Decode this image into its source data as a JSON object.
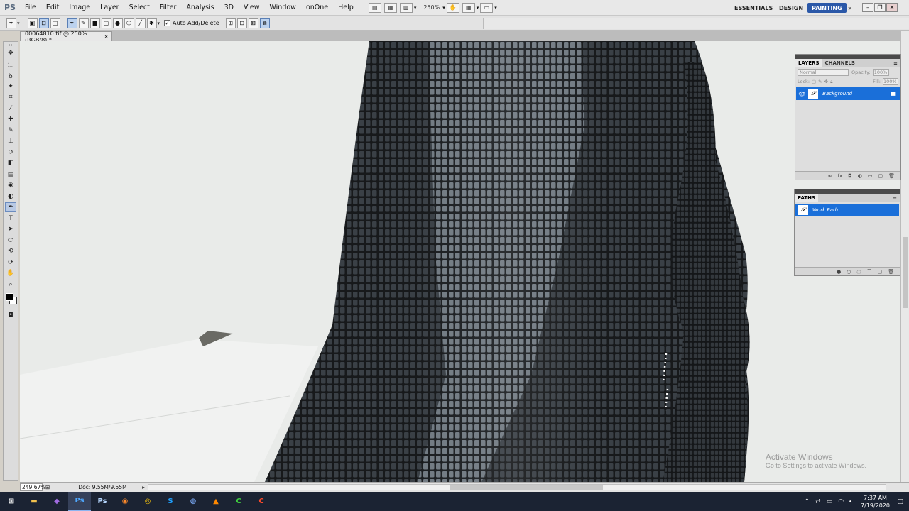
{
  "app": {
    "logo": "PS",
    "menus": [
      "File",
      "Edit",
      "Image",
      "Layer",
      "Select",
      "Filter",
      "Analysis",
      "3D",
      "View",
      "Window",
      "onOne",
      "Help"
    ],
    "zoom_select": "250%",
    "workspaces": [
      "ESSENTIALS",
      "DESIGN",
      "PAINTING"
    ]
  },
  "options": {
    "auto_add_delete": "Auto Add/Delete"
  },
  "document": {
    "tab_title": "00064810.tif @ 250% (RGB/8) *",
    "close": "×"
  },
  "status": {
    "zoom": "249.67%",
    "doc_info": "Doc: 9.55M/9.55M"
  },
  "layers_panel": {
    "tabs": [
      "LAYERS",
      "CHANNELS"
    ],
    "blend_mode": "Normal",
    "opacity_label": "Opacity:",
    "opacity_value": "100%",
    "lock_label": "Lock:",
    "fill_label": "Fill:",
    "fill_value": "100%",
    "layers": [
      {
        "name": "Background"
      }
    ]
  },
  "paths_panel": {
    "tabs": [
      "PATHS"
    ],
    "paths": [
      {
        "name": "Work Path"
      }
    ]
  },
  "watermark": {
    "title": "Activate Windows",
    "subtitle": "Go to Settings to activate Windows."
  },
  "taskbar": {
    "apps": [
      "windows-start",
      "file-explorer",
      "visual-studio",
      "photoshop",
      "photoshop-alt",
      "firefox",
      "chrome",
      "skype",
      "browser",
      "vlc",
      "camtasia",
      "snagit"
    ],
    "time": "7:37 AM",
    "date": "7/19/2020"
  },
  "colors": {
    "accent": "#1a6fd9",
    "workspace_active": "#2b58a8",
    "taskbar": "#1b2333"
  }
}
